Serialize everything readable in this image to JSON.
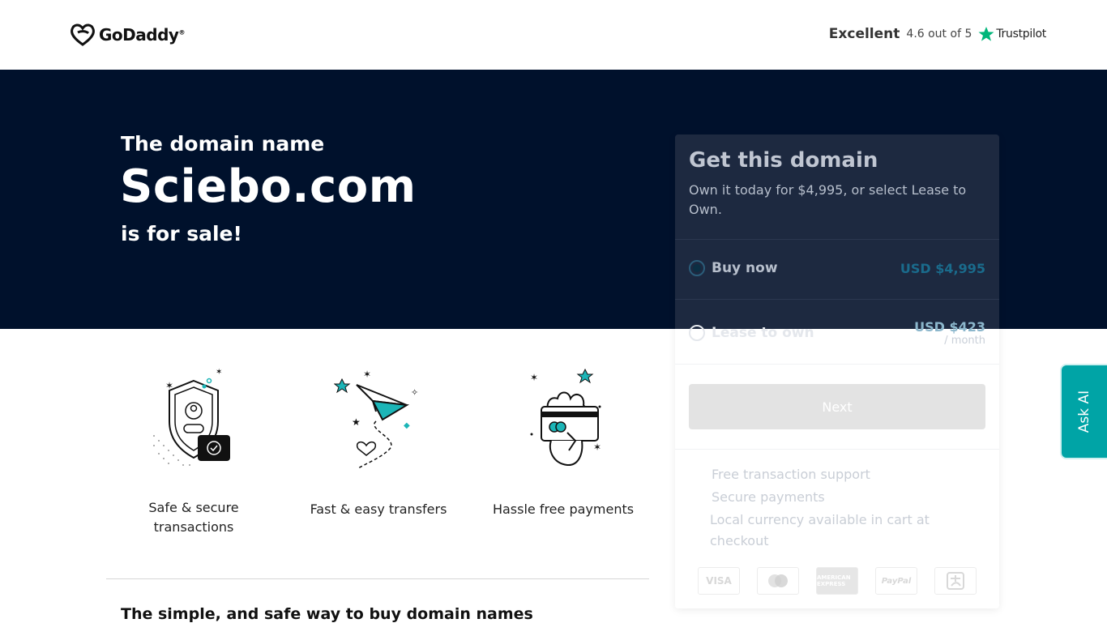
{
  "header": {
    "logo_text": "GoDaddy",
    "logo_tm": "®",
    "trust_rating_label": "Excellent",
    "trust_score": "4.6 out of 5",
    "trust_brand": "Trustpilot"
  },
  "hero": {
    "line1": "The domain name",
    "domain": "Sciebo.com",
    "line2": "is for sale!"
  },
  "features": [
    {
      "label": "Safe & secure transactions",
      "icon": "shield-user-icon"
    },
    {
      "label": "Fast & easy transfers",
      "icon": "paper-plane-icon"
    },
    {
      "label": "Hassle free payments",
      "icon": "hand-card-icon"
    }
  ],
  "bottom_title": "The simple, and safe way to buy domain names",
  "card": {
    "title": "Get this domain",
    "description": "Own it today for $4,995, or select Lease to Own.",
    "options": [
      {
        "label": "Buy now",
        "price": "USD $4,995",
        "selected": true
      },
      {
        "label": "Lease to own",
        "price": "USD $423",
        "sub": "/ month",
        "selected": false
      }
    ],
    "next_label": "Next",
    "benefits": [
      "Free transaction support",
      "Secure payments",
      "Local currency available in cart at checkout"
    ],
    "payment_methods": [
      "VISA",
      "mastercard-icon",
      "AMERICAN EXPRESS",
      "PayPal",
      "alipay-icon"
    ]
  },
  "ask_ai_label": "Ask AI",
  "colors": {
    "hero_bg": "#00112c",
    "accent_teal": "#00a4a6",
    "trustpilot_green": "#00b67a"
  }
}
